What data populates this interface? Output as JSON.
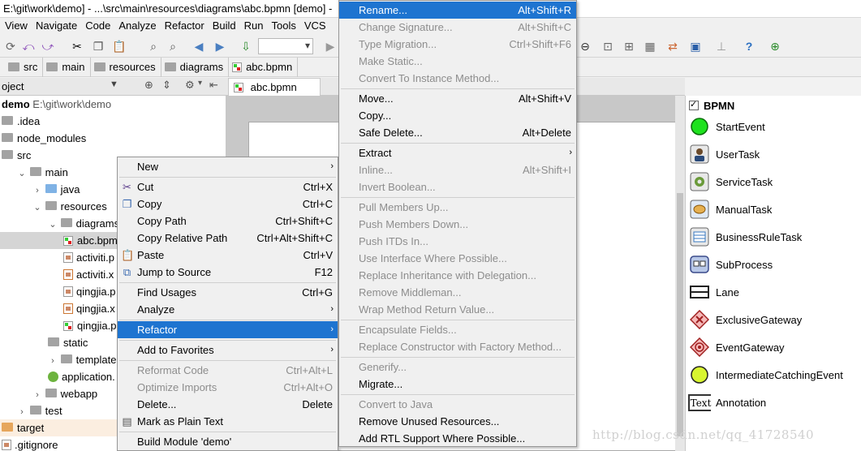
{
  "window": {
    "title": "E:\\git\\work\\demo] - ...\\src\\main\\resources\\diagrams\\abc.bpmn [demo] -"
  },
  "menubar": [
    "View",
    "Navigate",
    "Code",
    "Analyze",
    "Refactor",
    "Build",
    "Run",
    "Tools",
    "VCS"
  ],
  "breadcrumb": [
    "src",
    "main",
    "resources",
    "diagrams",
    "abc.bpmn"
  ],
  "project": {
    "header": "oject",
    "tree": [
      {
        "label": "demo",
        "path": "E:\\git\\work\\demo",
        "kind": "module",
        "indent": 0
      },
      {
        "label": ".idea",
        "kind": "folder",
        "indent": 0
      },
      {
        "label": "node_modules",
        "kind": "folder",
        "indent": 0
      },
      {
        "label": "src",
        "kind": "folder",
        "indent": 0
      },
      {
        "label": "main",
        "kind": "folder",
        "indent": 1,
        "arrow": "v"
      },
      {
        "label": "java",
        "kind": "folder-blue",
        "indent": 2,
        "arrow": ">"
      },
      {
        "label": "resources",
        "kind": "folder",
        "indent": 2,
        "arrow": "v"
      },
      {
        "label": "diagrams",
        "kind": "folder",
        "indent": 3,
        "arrow": "v"
      },
      {
        "label": "abc.bpm",
        "kind": "bpmn",
        "indent": 4,
        "selected": true
      },
      {
        "label": "activiti.p",
        "kind": "file",
        "indent": 4
      },
      {
        "label": "activiti.x",
        "kind": "xml",
        "indent": 4
      },
      {
        "label": "qingjia.p",
        "kind": "file",
        "indent": 4
      },
      {
        "label": "qingjia.x",
        "kind": "xml",
        "indent": 4
      },
      {
        "label": "qingjia.p",
        "kind": "bpmn",
        "indent": 4
      },
      {
        "label": "static",
        "kind": "folder",
        "indent": 3
      },
      {
        "label": "templates",
        "kind": "folder",
        "indent": 3,
        "arrow": ">"
      },
      {
        "label": "application.",
        "kind": "app",
        "indent": 3
      },
      {
        "label": "webapp",
        "kind": "folder",
        "indent": 2,
        "arrow": ">"
      },
      {
        "label": "test",
        "kind": "folder",
        "indent": 1,
        "arrow": ">"
      },
      {
        "label": "target",
        "kind": "folder-orange",
        "indent": 0,
        "target": true
      },
      {
        "label": ".gitignore",
        "kind": "file",
        "indent": 0
      }
    ]
  },
  "editor": {
    "tab": "abc.bpmn"
  },
  "palette": {
    "title": "BPMN",
    "items": [
      {
        "label": "StartEvent",
        "icon": "start-event-icon"
      },
      {
        "label": "UserTask",
        "icon": "user-task-icon"
      },
      {
        "label": "ServiceTask",
        "icon": "service-task-icon"
      },
      {
        "label": "ManualTask",
        "icon": "manual-task-icon"
      },
      {
        "label": "BusinessRuleTask",
        "icon": "business-rule-task-icon"
      },
      {
        "label": "SubProcess",
        "icon": "subprocess-icon"
      },
      {
        "label": "Lane",
        "icon": "lane-icon"
      },
      {
        "label": "ExclusiveGateway",
        "icon": "exclusive-gateway-icon"
      },
      {
        "label": "EventGateway",
        "icon": "event-gateway-icon"
      },
      {
        "label": "IntermediateCatchingEvent",
        "icon": "intermediate-catching-event-icon"
      },
      {
        "label": "Annotation",
        "icon": "annotation-icon",
        "icon_text": "Text"
      }
    ]
  },
  "context_menu": {
    "items": [
      {
        "label": "New",
        "sub": true
      },
      {
        "sep": true
      },
      {
        "label": "Cut",
        "shortcut": "Ctrl+X",
        "icon": "scissors-icon"
      },
      {
        "label": "Copy",
        "shortcut": "Ctrl+C",
        "icon": "copy-icon"
      },
      {
        "label": "Copy Path",
        "shortcut": "Ctrl+Shift+C"
      },
      {
        "label": "Copy Relative Path",
        "shortcut": "Ctrl+Alt+Shift+C"
      },
      {
        "label": "Paste",
        "shortcut": "Ctrl+V",
        "icon": "paste-icon"
      },
      {
        "label": "Jump to Source",
        "shortcut": "F12",
        "icon": "jump-to-source-icon"
      },
      {
        "sep": true
      },
      {
        "label": "Find Usages",
        "shortcut": "Ctrl+G"
      },
      {
        "label": "Analyze",
        "sub": true
      },
      {
        "sep": true
      },
      {
        "label": "Refactor",
        "sub": true,
        "highlight": true
      },
      {
        "sep": true
      },
      {
        "label": "Add to Favorites",
        "sub": true
      },
      {
        "sep": true
      },
      {
        "label": "Reformat Code",
        "shortcut": "Ctrl+Alt+L",
        "disabled": true
      },
      {
        "label": "Optimize Imports",
        "shortcut": "Ctrl+Alt+O",
        "disabled": true
      },
      {
        "label": "Delete...",
        "shortcut": "Delete"
      },
      {
        "label": "Mark as Plain Text",
        "icon": "plain-text-icon"
      },
      {
        "sep": true
      },
      {
        "label": "Build Module 'demo'"
      }
    ]
  },
  "refactor_menu": {
    "items": [
      {
        "label": "Rename...",
        "shortcut": "Alt+Shift+R",
        "highlight": true
      },
      {
        "label": "Change Signature...",
        "shortcut": "Alt+Shift+C",
        "disabled": true
      },
      {
        "label": "Type Migration...",
        "shortcut": "Ctrl+Shift+F6",
        "disabled": true
      },
      {
        "label": "Make Static...",
        "disabled": true
      },
      {
        "label": "Convert To Instance Method...",
        "disabled": true
      },
      {
        "sep": true
      },
      {
        "label": "Move...",
        "shortcut": "Alt+Shift+V"
      },
      {
        "label": "Copy..."
      },
      {
        "label": "Safe Delete...",
        "shortcut": "Alt+Delete"
      },
      {
        "sep": true
      },
      {
        "label": "Extract",
        "sub": true
      },
      {
        "label": "Inline...",
        "shortcut": "Alt+Shift+I",
        "disabled": true
      },
      {
        "label": "Invert Boolean...",
        "disabled": true
      },
      {
        "sep": true
      },
      {
        "label": "Pull Members Up...",
        "disabled": true
      },
      {
        "label": "Push Members Down...",
        "disabled": true
      },
      {
        "label": "Push ITDs In...",
        "disabled": true
      },
      {
        "label": "Use Interface Where Possible...",
        "disabled": true
      },
      {
        "label": "Replace Inheritance with Delegation...",
        "disabled": true
      },
      {
        "label": "Remove Middleman...",
        "disabled": true
      },
      {
        "label": "Wrap Method Return Value...",
        "disabled": true
      },
      {
        "sep": true
      },
      {
        "label": "Encapsulate Fields...",
        "disabled": true
      },
      {
        "label": "Replace Constructor with Factory Method...",
        "disabled": true
      },
      {
        "sep": true
      },
      {
        "label": "Generify...",
        "disabled": true
      },
      {
        "label": "Migrate..."
      },
      {
        "sep": true
      },
      {
        "label": "Convert to Java",
        "disabled": true
      },
      {
        "label": "Remove Unused Resources..."
      },
      {
        "label": "Add RTL Support Where Possible..."
      }
    ]
  },
  "watermark": "http://blog.csdn.net/qq_41728540"
}
